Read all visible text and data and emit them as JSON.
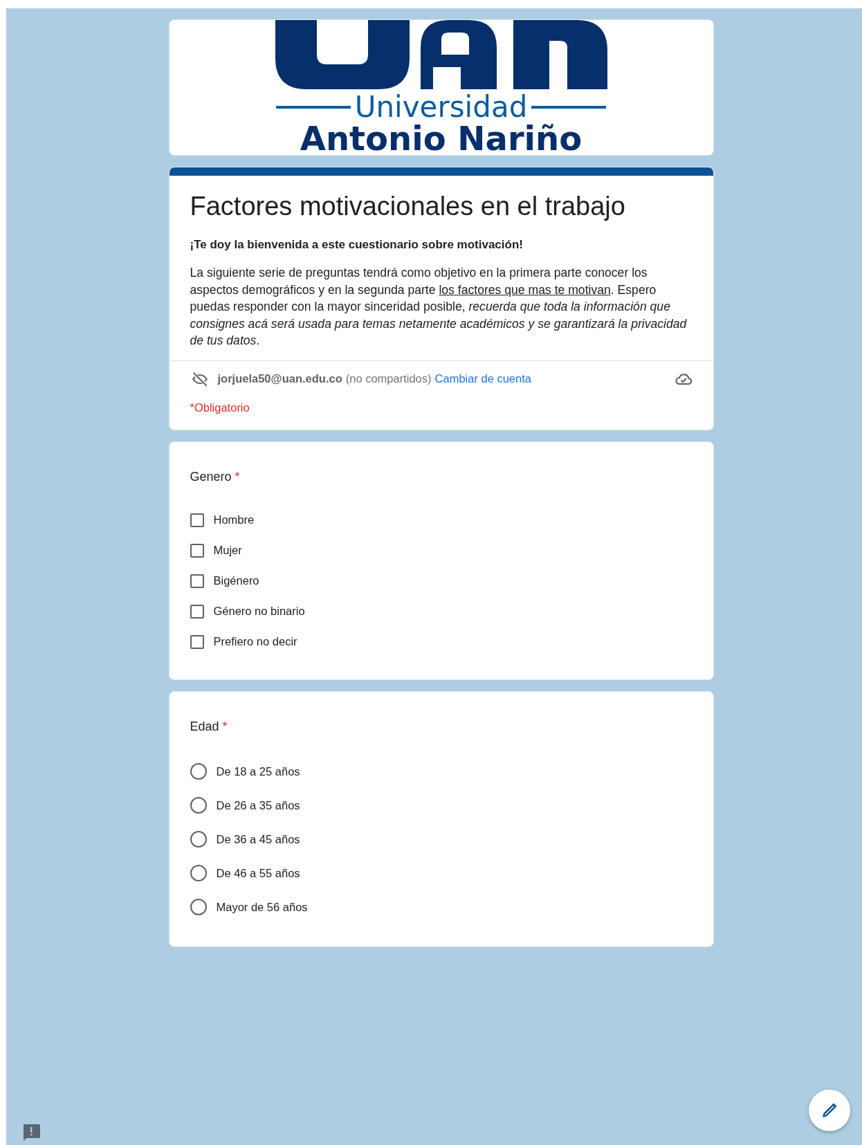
{
  "banner": {
    "subtitle": "Universidad",
    "name": "Antonio Nariño"
  },
  "header": {
    "title": "Factores motivacionales en el trabajo",
    "welcome": "¡Te doy la bienvenida a este cuestionario sobre motivación!",
    "description": [
      {
        "kind": "plain",
        "text": "La siguiente serie de preguntas tendrá como objetivo en la primera parte conocer los aspectos demográficos y en la segunda parte "
      },
      {
        "kind": "underline",
        "text": "los factores que mas te motivan"
      },
      {
        "kind": "plain",
        "text": ". Espero puedas responder con la mayor sinceridad posible, "
      },
      {
        "kind": "italic",
        "text": "recuerda que toda la información que consignes acá será usada para temas netamente académicos y se garantizará la privacidad de tus datos"
      },
      {
        "kind": "plain",
        "text": "."
      }
    ],
    "account": {
      "email": "jorjuela50@uan.edu.co",
      "note": "(no compartidos)",
      "switch_link": "Cambiar de cuenta"
    },
    "required_note": "*Obligatorio"
  },
  "questions": [
    {
      "title": "Genero",
      "required_mark": "*",
      "kind": "checkbox",
      "options": [
        {
          "label": "Hombre",
          "checked": false
        },
        {
          "label": "Mujer",
          "checked": false
        },
        {
          "label": "Bigénero",
          "checked": false
        },
        {
          "label": "Género no binario",
          "checked": false
        },
        {
          "label": "Prefiero no decir",
          "checked": false
        }
      ]
    },
    {
      "title": "Edad",
      "required_mark": "*",
      "kind": "radio",
      "options": [
        {
          "label": "De 18 a 25 años",
          "selected": false
        },
        {
          "label": "De 26 a 35 años",
          "selected": false
        },
        {
          "label": "De 36 a 45 años",
          "selected": false
        },
        {
          "label": "De 46 a 55 años",
          "selected": false
        },
        {
          "label": "Mayor de 56 años",
          "selected": false
        }
      ]
    }
  ]
}
